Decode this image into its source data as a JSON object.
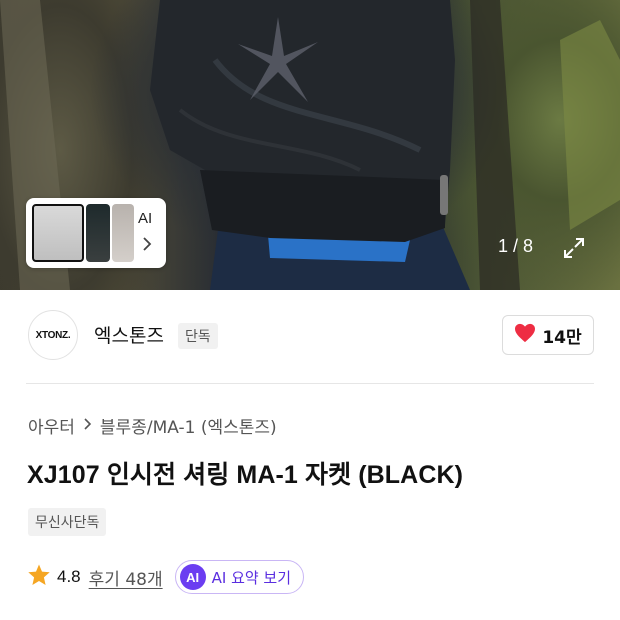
{
  "gallery": {
    "thumbnail_ai_label": "AI",
    "pager": "1 / 8"
  },
  "brand": {
    "logo_text": "XTONZ.",
    "name": "엑스톤즈",
    "badge": "단독",
    "likes": "14만"
  },
  "breadcrumb": {
    "category": "아우터",
    "subcategory": "블루종/MA-1 (엑스톤즈)"
  },
  "product": {
    "title": "XJ107 인시전 셔링 MA-1 자켓 (BLACK)",
    "tag": "무신사단독"
  },
  "rating": {
    "score": "4.8",
    "reviews": "후기 48개",
    "ai_icon": "AI",
    "ai_summary": "AI 요약 보기"
  },
  "colors": {
    "heart": "#ee2d43",
    "star": "#f5a623",
    "ai_purple": "#6b3df1"
  },
  "icons": [
    "chevron-right-icon",
    "expand-icon",
    "heart-icon",
    "star-icon",
    "ai-icon"
  ]
}
